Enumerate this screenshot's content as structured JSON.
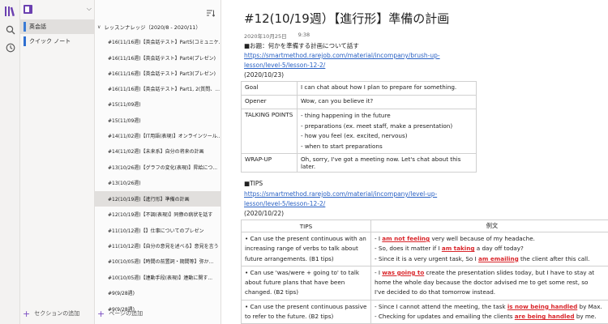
{
  "rail": {
    "icons": [
      "library-icon",
      "search-icon",
      "history-icon"
    ]
  },
  "notebook": {
    "name": "",
    "sections": [
      {
        "label": "英会話",
        "color": "#3a7bd5",
        "active": true
      },
      {
        "label": "クイック ノート",
        "color": "#2f6fd0",
        "active": false
      }
    ],
    "add_section_label": "セクションの追加"
  },
  "pages": {
    "group_title": "レッスンナレッジ（2020/8 - 2020/11）",
    "items": [
      {
        "label": "#16(11/16週)【英会話テスト】Part5(コミュニケ..."
      },
      {
        "label": "#16(11/16週)【英会話テスト】Part4(プレゼン)"
      },
      {
        "label": "#16(11/16週)【英会話テスト】Part3(プレゼン)"
      },
      {
        "label": "#16(11/16週)【英会話テスト】Part1, 2(質問、..."
      },
      {
        "label": "#15(11/09週)"
      },
      {
        "label": "#15(11/09週)"
      },
      {
        "label": "#14(11/02週)【IT用語(表現)】オンラインツール..."
      },
      {
        "label": "#14(11/02週)【未来系】自分の将来の計画"
      },
      {
        "label": "#13(10/26週)【グラフの変化(表現)】昇給につ..."
      },
      {
        "label": "#13(10/26週)"
      },
      {
        "label": "#12(10/19週)【進行形】準備の計画"
      },
      {
        "label": "#12(10/19週)【不調(表現)】同僚の病状を話す"
      },
      {
        "label": "#11(10/12週)【】仕事についてのプレゼン"
      },
      {
        "label": "#11(10/12週)【自分の意見を述べる】意見を言う"
      },
      {
        "label": "#10(10/05週)【時間の前置詞・期間等】弥か..."
      },
      {
        "label": "#10(10/05週)【連動手段(表現)】連動に関す..."
      },
      {
        "label": "#9(9/28週)"
      },
      {
        "label": "#9(9/28週)"
      }
    ],
    "active_index": 10,
    "add_page_label": "ページの追加"
  },
  "content": {
    "title": "#12(10/19週）【進行形】準備の計画",
    "date": "2020年10月25日",
    "time": "9:38",
    "topic": "■お題：何かを準備する計画について話す",
    "link1_a": "https://smartmethod.rarejob.com/material/incompany/brush-up-",
    "link1_b": "lesson/level-5/lesson-12-2/",
    "date1": "(2020/10/23)",
    "table1": [
      {
        "key": "Goal",
        "value": "I can chat about how I plan to prepare for something."
      },
      {
        "key": "Opener",
        "value": "Wow, can you believe it?"
      },
      {
        "key": "TALKING POINTS",
        "items": [
          "- thing happening in the future",
          "- preparations (ex. meet staff, make a presentation)",
          "- how you feel (ex. excited, nervous)",
          "- when to start preparations"
        ]
      },
      {
        "key": "WRAP-UP",
        "value": "Oh, sorry, I've got a meeting now. Let's chat about this later."
      }
    ],
    "tips_heading": "■TIPS",
    "link2_a": "https://smartmethod.rarejob.com/material/incompany/level-up-",
    "link2_b": "lesson/level-5/lesson-12-2/",
    "date2": "(2020/10/22)",
    "table2": {
      "headers": [
        "TIPS",
        "例文"
      ],
      "rows": [
        {
          "tip": [
            "• Can use the present continuous with an",
            "increasing range of verbs to talk about",
            "future arrangements. (B1 tips)"
          ],
          "examples": [
            {
              "pre": "- I ",
              "hl": "am not feeling",
              "post": " very well because of my headache."
            },
            {
              "pre": "- So, does it matter if I ",
              "hl": "am taking",
              "post": " a day off today?"
            },
            {
              "pre": "- Since it is a very urgent task, So I ",
              "hl": "am emailing",
              "post": " the client after this call."
            }
          ]
        },
        {
          "tip": [
            "• Can use 'was/were + going to' to talk",
            "about future plans that have been",
            "changed. (B2 tips)"
          ],
          "examples": [
            {
              "pre": "- I ",
              "hl": "was going to",
              "post": " create the presentation slides today, but I have to stay at"
            },
            {
              "pre": "home the whole day because the doctor advised me to get some rest, so",
              "hl": "",
              "post": ""
            },
            {
              "pre": "I've decided to do that tomorrow instead.",
              "hl": "",
              "post": ""
            }
          ]
        },
        {
          "tip": [
            "• Can use the present continuous passive",
            "to refer to the future. (B2 tips)"
          ],
          "examples": [
            {
              "pre": "- Since I cannot attend the meeting, the task ",
              "hl": "is now being handled",
              "post": " by Max."
            },
            {
              "pre": "- Checking for updates and emailing the clients ",
              "hl": "are being handled",
              "post": " by me."
            }
          ]
        }
      ]
    }
  }
}
